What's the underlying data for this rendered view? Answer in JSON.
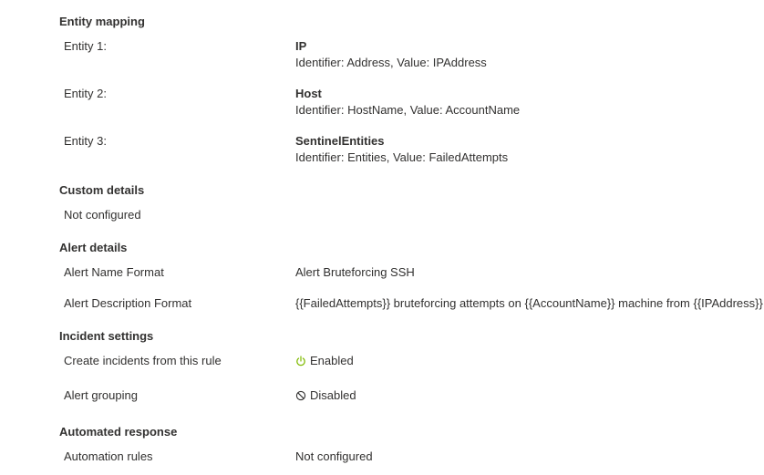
{
  "entity_mapping": {
    "title": "Entity mapping",
    "entities": [
      {
        "label": "Entity 1:",
        "name": "IP",
        "detail": "Identifier: Address, Value: IPAddress"
      },
      {
        "label": "Entity 2:",
        "name": "Host",
        "detail": "Identifier: HostName, Value: AccountName"
      },
      {
        "label": "Entity 3:",
        "name": "SentinelEntities",
        "detail": "Identifier: Entities, Value: FailedAttempts"
      }
    ]
  },
  "custom_details": {
    "title": "Custom details",
    "value": "Not configured"
  },
  "alert_details": {
    "title": "Alert details",
    "name_format_label": "Alert Name Format",
    "name_format_value": "Alert Bruteforcing SSH",
    "description_format_label": "Alert Description Format",
    "description_format_value": "{{FailedAttempts}} bruteforcing attempts on {{AccountName}} machine from {{IPAddress}}"
  },
  "incident_settings": {
    "title": "Incident settings",
    "create_label": "Create incidents from this rule",
    "create_value": "Enabled",
    "create_icon": "power-icon",
    "create_icon_color": "#7fba00",
    "grouping_label": "Alert grouping",
    "grouping_value": "Disabled",
    "grouping_icon": "disabled-icon",
    "grouping_icon_color": "#323130"
  },
  "automated_response": {
    "title": "Automated response",
    "rules_label": "Automation rules",
    "rules_value": "Not configured"
  }
}
